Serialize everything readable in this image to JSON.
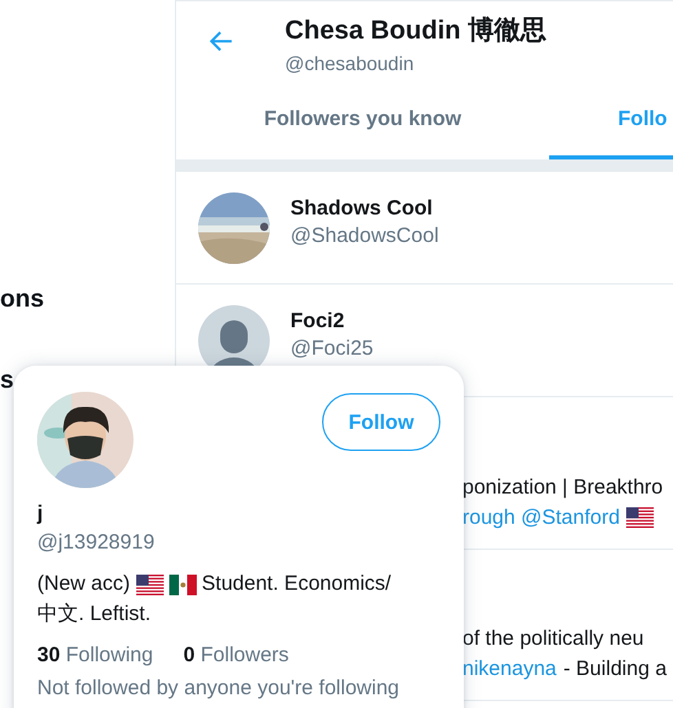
{
  "sidebar": {
    "items": [
      "ons",
      "s"
    ]
  },
  "header": {
    "title": "Chesa Boudin 博徹思",
    "handle": "@chesaboudin"
  },
  "tabs": [
    {
      "label": "Followers you know",
      "selected": false
    },
    {
      "label": "Follo",
      "selected": true
    }
  ],
  "users": [
    {
      "name": "Shadows Cool",
      "handle": "@ShadowsCool"
    },
    {
      "kind": "default",
      "name": "Foci2",
      "handle": "@Foci25"
    }
  ],
  "partial_rows": [
    {
      "lines": [
        {
          "kind": "plain",
          "text": "ponization | Breakthro"
        },
        {
          "kind": "link",
          "text": "rough @Stanford",
          "flag": true
        }
      ]
    },
    {
      "lines": [
        {
          "kind": "plain",
          "text": "of the politically neu"
        },
        {
          "kind": "mixed",
          "link": "nikenayna",
          "text": " - Building a"
        }
      ]
    }
  ],
  "hover_card": {
    "name": "j",
    "handle": "@j13928919",
    "button": "Follow",
    "bio_start": "(New acc)",
    "bio_end": "Student. Economics/",
    "bio_line2": "中文. Leftist.",
    "following_count": "30",
    "following_label": "Following",
    "followers_count": "0",
    "followers_label": "Followers",
    "note": "Not followed by anyone you're following"
  }
}
